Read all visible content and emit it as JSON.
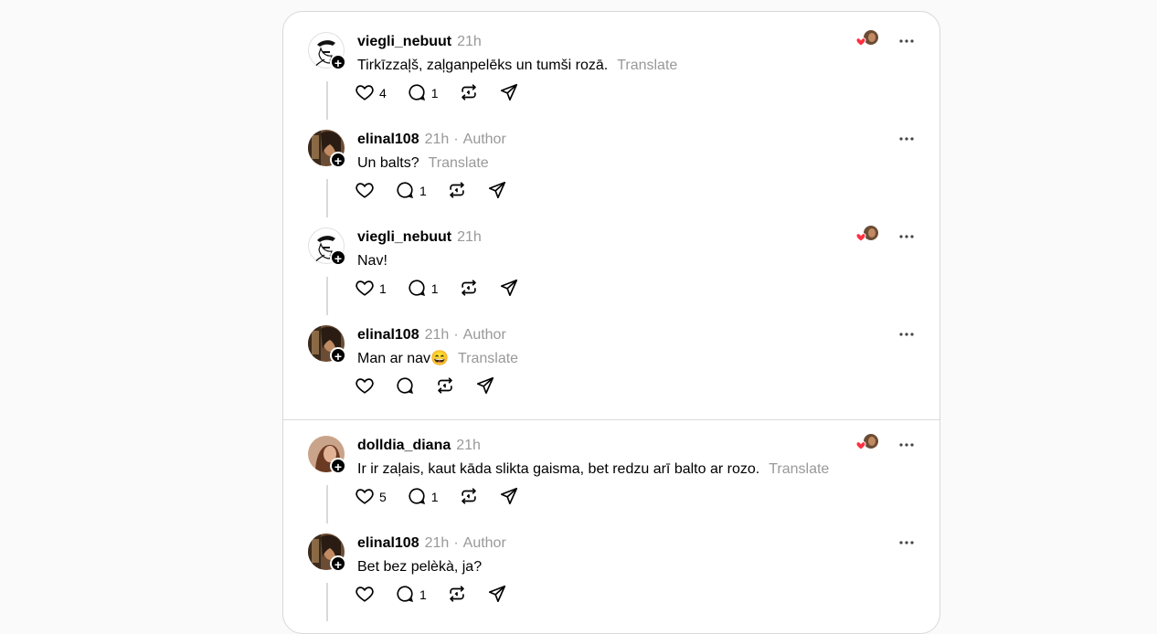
{
  "posts": [
    {
      "username": "viegli_nebuut",
      "time": "21h",
      "author": "",
      "text": "Tirkīzzaļš, zaļganpelēks un tumši rozā.",
      "translate": "Translate",
      "likes": "4",
      "replies": "1",
      "avatar": "bw",
      "reacts": true
    },
    {
      "username": "elinal108",
      "time": "21h",
      "author": "Author",
      "text": "Un balts?",
      "translate": "Translate",
      "likes": "",
      "replies": "1",
      "avatar": "photo1",
      "reacts": false
    },
    {
      "username": "viegli_nebuut",
      "time": "21h",
      "author": "",
      "text": "Nav!",
      "translate": "",
      "likes": "1",
      "replies": "1",
      "avatar": "bw",
      "reacts": true
    },
    {
      "username": "elinal108",
      "time": "21h",
      "author": "Author",
      "text": "Man ar nav😄",
      "translate": "Translate",
      "likes": "",
      "replies": "",
      "avatar": "photo1",
      "reacts": false
    },
    {
      "username": "dolldia_diana",
      "time": "21h",
      "author": "",
      "text": "Ir ir zaļais, kaut kāda slikta gaisma, bet redzu arī balto ar rozo.",
      "translate": "Translate",
      "likes": "5",
      "replies": "1",
      "avatar": "photo2",
      "reacts": true
    },
    {
      "username": "elinal108",
      "time": "21h",
      "author": "Author",
      "text": "Bet bez pelèkà, ja?",
      "translate": "",
      "likes": "",
      "replies": "1",
      "avatar": "photo1",
      "reacts": false
    }
  ],
  "icons": {
    "like": "heart-icon",
    "reply": "comment-icon",
    "repost": "repost-icon",
    "share": "send-icon",
    "more": "more-icon",
    "follow": "plus-icon"
  },
  "colors": {
    "muted": "#999999",
    "border": "#d9d9d9",
    "heart": "#ff3040"
  }
}
